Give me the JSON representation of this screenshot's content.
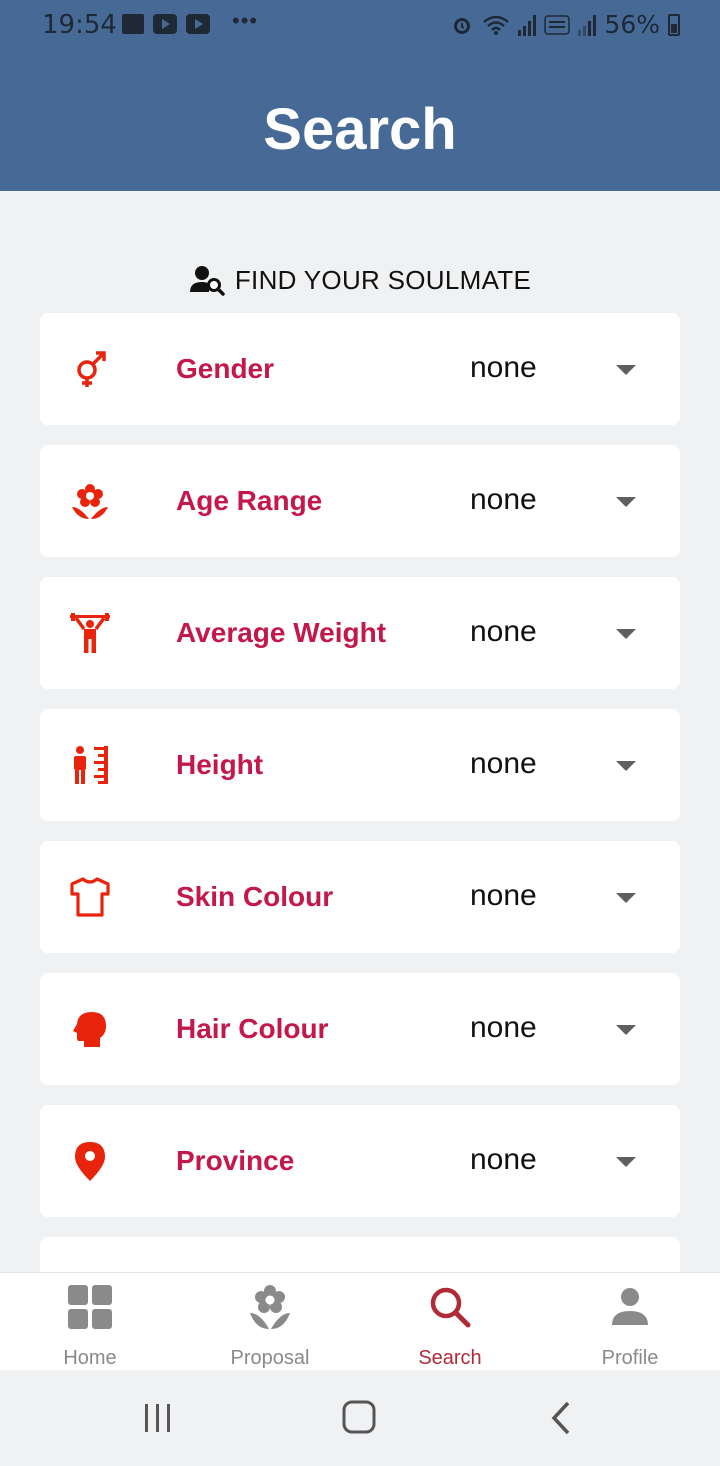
{
  "status_bar": {
    "time": "19:54",
    "more": "•••",
    "battery": "56%"
  },
  "header": {
    "title": "Search"
  },
  "section": {
    "heading": "FIND YOUR SOULMATE",
    "icon": "person-search-icon"
  },
  "filters": [
    {
      "label": "Gender",
      "value": "none",
      "icon": "gender-icon"
    },
    {
      "label": "Age Range",
      "value": "none",
      "icon": "flower-icon"
    },
    {
      "label": "Average Weight",
      "value": "none",
      "icon": "weightlifter-icon"
    },
    {
      "label": "Height",
      "value": "none",
      "icon": "height-ruler-icon"
    },
    {
      "label": "Skin Colour",
      "value": "none",
      "icon": "tshirt-icon"
    },
    {
      "label": "Hair Colour",
      "value": "none",
      "icon": "head-profile-icon"
    },
    {
      "label": "Province",
      "value": "none",
      "icon": "map-pin-icon"
    }
  ],
  "nav": {
    "home": "Home",
    "proposal": "Proposal",
    "search": "Search",
    "profile": "Profile",
    "active": "Search"
  },
  "colors": {
    "app_bar": "#466a95",
    "label": "#c4174b",
    "icon": "#e8240c",
    "active_nav": "#b02a37"
  }
}
